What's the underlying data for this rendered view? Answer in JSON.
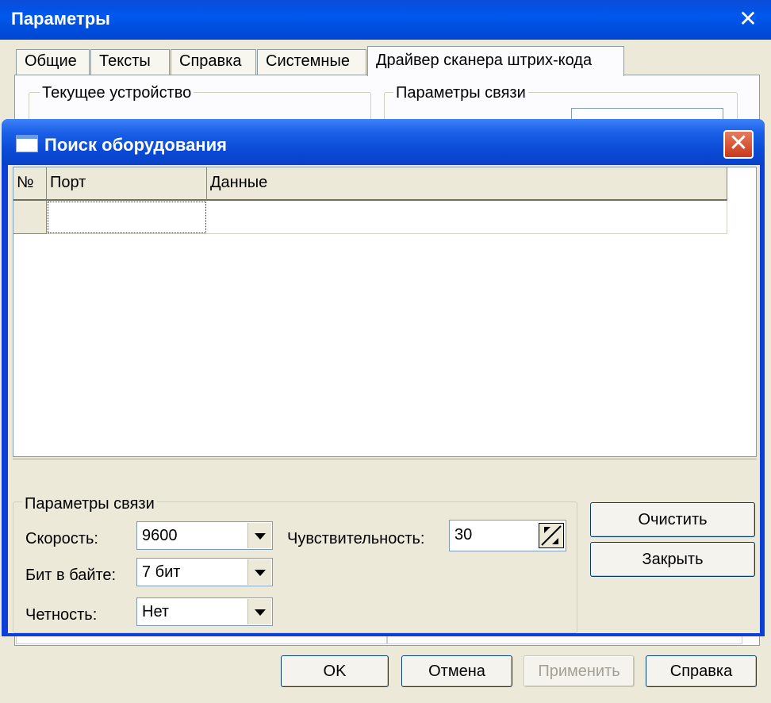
{
  "outer": {
    "title": "Параметры",
    "close_glyph": "✕",
    "tabs": [
      "Общие",
      "Тексты",
      "Справка",
      "Системные",
      "Драйвер сканера штрих-кода"
    ],
    "group_current_device": "Текущее устройство",
    "group_connection": "Параметры связи",
    "buttons": {
      "ok": "OK",
      "cancel": "Отмена",
      "apply": "Применить",
      "help": "Справка"
    }
  },
  "dialog": {
    "title": "Поиск оборудования",
    "close_glyph": "✕",
    "grid": {
      "columns": [
        "№",
        "Порт",
        "Данные"
      ],
      "rows": [
        [
          "",
          "",
          ""
        ]
      ]
    },
    "params": {
      "group_label": "Параметры связи",
      "speed_label": "Скорость:",
      "speed_value": "9600",
      "bits_label": "Бит в байте:",
      "bits_value": "7 бит",
      "parity_label": "Четность:",
      "parity_value": "Нет",
      "sensitivity_label": "Чувствительность:",
      "sensitivity_value": "30"
    },
    "buttons": {
      "clear": "Очистить",
      "close": "Закрыть"
    }
  },
  "icons": {
    "window": "window-icon",
    "close": "close-icon",
    "dropdown": "chevron-down-icon",
    "spin": "spin-updown-icon"
  }
}
